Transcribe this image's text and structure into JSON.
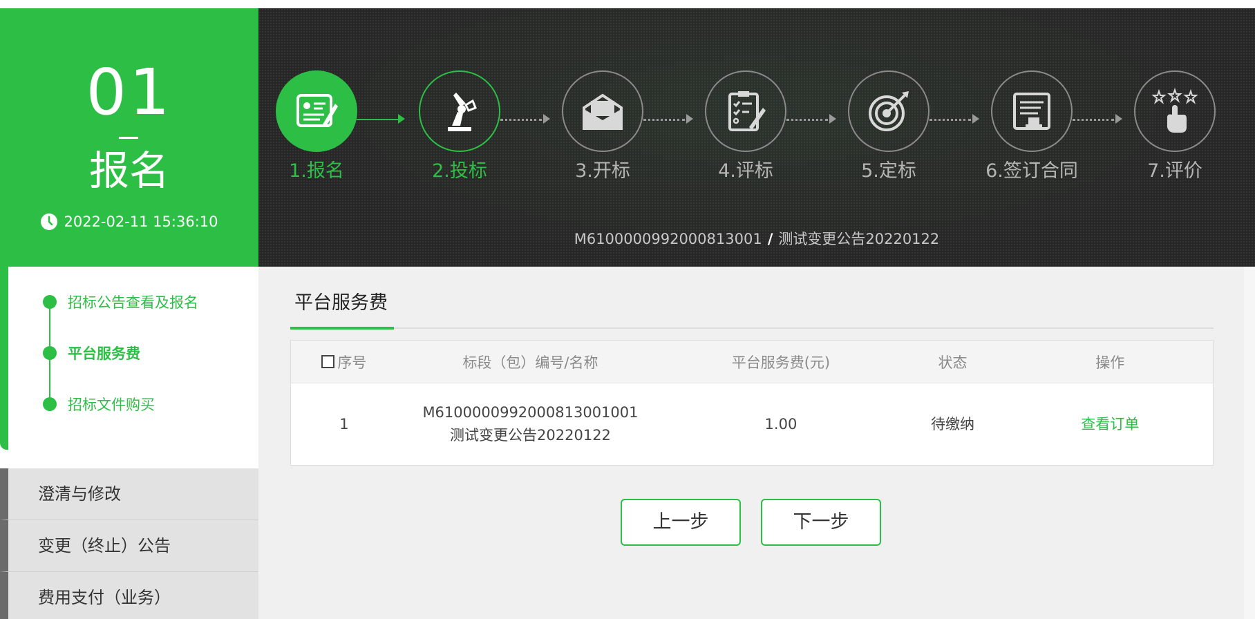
{
  "phase": {
    "number": "01",
    "name": "报名",
    "datetime": "2022-02-11 15:36:10"
  },
  "steps": [
    {
      "label": "1.报名",
      "icon": "registration-form-icon",
      "state": "done"
    },
    {
      "label": "2.投标",
      "icon": "robot-arm-icon",
      "state": "current"
    },
    {
      "label": "3.开标",
      "icon": "open-envelope-icon",
      "state": "pending"
    },
    {
      "label": "4.评标",
      "icon": "clipboard-evaluate-icon",
      "state": "pending"
    },
    {
      "label": "5.定标",
      "icon": "target-dart-icon",
      "state": "pending"
    },
    {
      "label": "6.签订合同",
      "icon": "contract-stamp-icon",
      "state": "pending"
    },
    {
      "label": "7.评价",
      "icon": "rating-stars-icon",
      "state": "pending"
    }
  ],
  "project": {
    "code": "M6100000992000813001",
    "separator": "/",
    "name": "测试变更公告20220122"
  },
  "timeline": [
    {
      "label": "招标公告查看及报名",
      "active": false
    },
    {
      "label": "平台服务费",
      "active": true
    },
    {
      "label": "招标文件购买",
      "active": false
    }
  ],
  "menu": [
    {
      "label": "澄清与修改"
    },
    {
      "label": "变更（终止）公告"
    },
    {
      "label": "费用支付（业务）"
    }
  ],
  "content": {
    "title": "平台服务费",
    "table": {
      "headers": [
        "序号",
        "标段（包）编号/名称",
        "平台服务费(元)",
        "状态",
        "操作"
      ],
      "rows": [
        {
          "index": "1",
          "section_code": "M6100000992000813001001",
          "section_name": "测试变更公告20220122",
          "fee": "1.00",
          "status": "待缴纳",
          "action": "查看订单"
        }
      ]
    },
    "prev_label": "上一步",
    "next_label": "下一步"
  },
  "colors": {
    "accent": "#2dbf45",
    "banner_bg": "#262626"
  }
}
